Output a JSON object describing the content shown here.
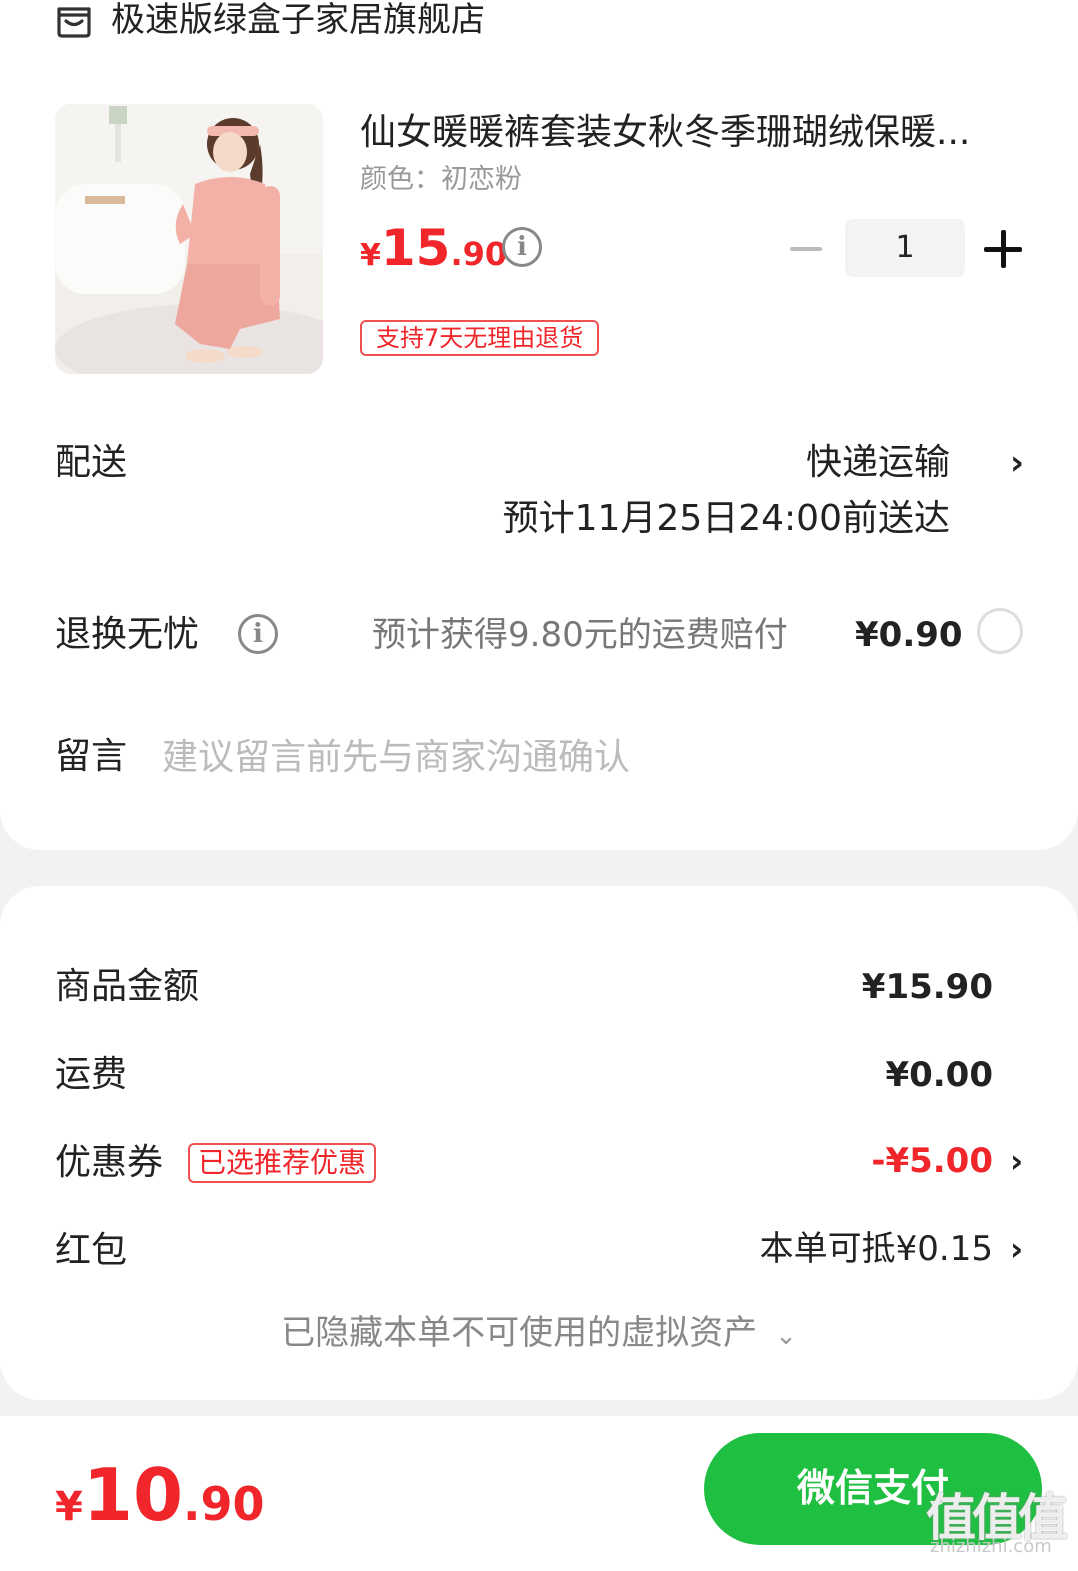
{
  "shop": {
    "name": "极速版绿盒子家居旗舰店"
  },
  "product": {
    "title": "仙女暖暖裤套装女秋冬季珊瑚绒保暖...",
    "variant": "颜色：初恋粉",
    "price": {
      "currency": "¥",
      "integer": "15",
      "decimal": ".90"
    },
    "quantity": "1",
    "return_badge": "支持7天无理由退货"
  },
  "delivery": {
    "label": "配送",
    "method": "快递运输",
    "eta": "预计11月25日24:00前送达"
  },
  "return_insurance": {
    "label": "退换无忧",
    "note": "预计获得9.80元的运费赔付",
    "price": "¥0.90"
  },
  "message": {
    "label": "留言",
    "placeholder": "建议留言前先与商家沟通确认"
  },
  "summary": {
    "goods_label": "商品金额",
    "goods_value": "¥15.90",
    "shipping_label": "运费",
    "shipping_value": "¥0.00",
    "coupon_label": "优惠券",
    "coupon_badge": "已选推荐优惠",
    "coupon_value": "-¥5.00",
    "redpacket_label": "红包",
    "redpacket_value": "本单可抵¥0.15",
    "hidden_assets": "已隐藏本单不可使用的虚拟资产"
  },
  "footer": {
    "total": {
      "currency": "¥",
      "integer": "10",
      "decimal": ".90"
    },
    "pay_label": "微信支付"
  },
  "watermark": {
    "big": "值值值",
    "small": "zhizhizhi.com"
  },
  "colors": {
    "price_red": "#f0262a",
    "pay_green": "#1fbf42"
  },
  "icons": [
    "shop-icon",
    "info-icon",
    "chevron-right-icon",
    "chevron-down-icon",
    "minus-icon",
    "plus-icon",
    "radio-icon"
  ]
}
